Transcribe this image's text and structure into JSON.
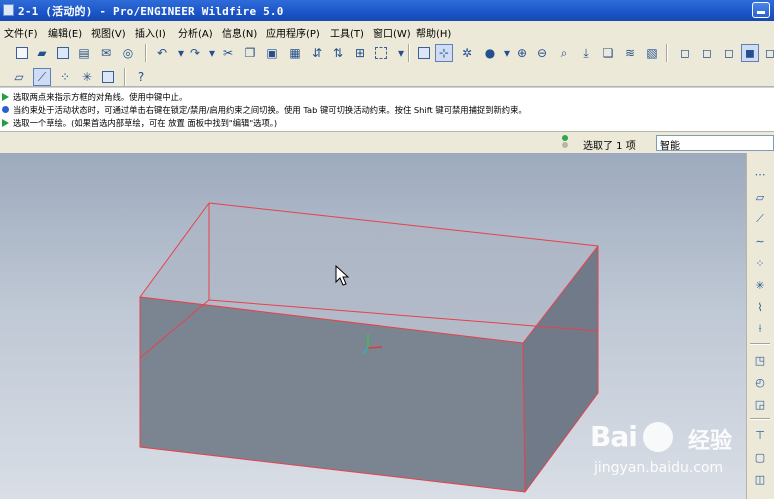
{
  "window": {
    "title": "2-1 (活动的) - Pro/ENGINEER Wildfire 5.0"
  },
  "menu": [
    {
      "label": "文件(F)"
    },
    {
      "label": "编辑(E)"
    },
    {
      "label": "视图(V)"
    },
    {
      "label": "插入(I)"
    },
    {
      "label": "分析(A)"
    },
    {
      "label": "信息(N)"
    },
    {
      "label": "应用程序(P)"
    },
    {
      "label": "工具(T)"
    },
    {
      "label": "窗口(W)"
    },
    {
      "label": "帮助(H)"
    }
  ],
  "messages": [
    {
      "icon": "green-arrow",
      "text": "选取两点来指示方框的对角线。使用中键中止。"
    },
    {
      "icon": "blue-dot",
      "text": "当约束处于活动状态时，可通过单击右键在锁定/禁用/启用约束之间切换。使用 Tab 键可切换活动约束。按住 Shift 键可禁用捕捉到新约束。"
    },
    {
      "icon": "green-arrow",
      "text": "选取一个草绘。(如果首选内部草绘，可在 放置 面板中找到\"编辑\"选项。)"
    }
  ],
  "status": {
    "selection_text": "选取了 1 项",
    "filter_value": "智能"
  },
  "watermark": {
    "brand": "Bai",
    "brand_suffix": "经验",
    "url": "jingyan.baidu.com"
  },
  "colors": {
    "edge": "#e8404c",
    "box_front": "#7b8592",
    "box_side": "#707a88",
    "box_top": "#aeb6c4"
  }
}
